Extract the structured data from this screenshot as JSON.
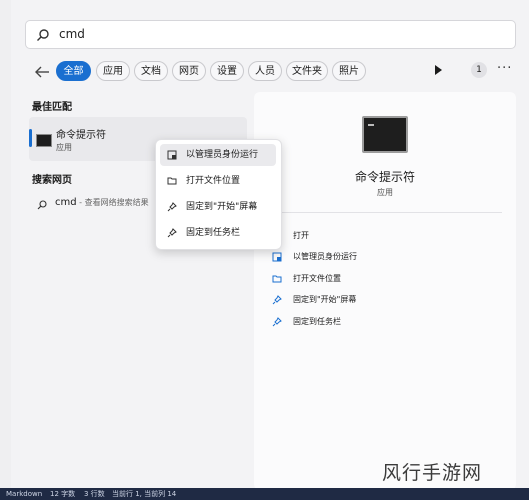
{
  "search": {
    "value": "cmd"
  },
  "filters": {
    "tabs": [
      "全部",
      "应用",
      "文档",
      "网页",
      "设置",
      "人员",
      "文件夹",
      "照片"
    ],
    "count": "1",
    "more": "···"
  },
  "best_match": {
    "heading": "最佳匹配",
    "title": "命令提示符",
    "subtitle": "应用"
  },
  "web_search": {
    "heading": "搜索网页",
    "query": "cmd",
    "hint": " - 查看网络搜索结果"
  },
  "context_menu": {
    "items": [
      "以管理员身份运行",
      "打开文件位置",
      "固定到\"开始\"屏幕",
      "固定到任务栏"
    ]
  },
  "detail": {
    "title": "命令提示符",
    "subtitle": "应用",
    "actions": [
      "打开",
      "以管理员身份运行",
      "打开文件位置",
      "固定到\"开始\"屏幕",
      "固定到任务栏"
    ]
  },
  "statusbar": {
    "mode": "Markdown",
    "words": "12 字数",
    "lines": "3 行数",
    "pos": "当前行 1, 当前列 14"
  },
  "watermark": "风行手游网",
  "colors": {
    "accent": "#1a6fd0"
  }
}
